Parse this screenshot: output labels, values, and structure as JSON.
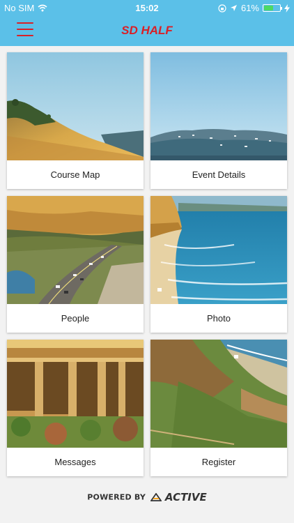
{
  "status": {
    "carrier": "No SIM",
    "time": "15:02",
    "battery": "61%",
    "battery_level": 0.61
  },
  "header": {
    "title": "SD HALF"
  },
  "tiles": [
    {
      "label": "Course Map"
    },
    {
      "label": "Event Details"
    },
    {
      "label": "People"
    },
    {
      "label": "Photo"
    },
    {
      "label": "Messages"
    },
    {
      "label": "Register"
    }
  ],
  "footer": {
    "powered_by": "POWERED BY",
    "brand": "ACTIVE"
  },
  "colors": {
    "bar": "#5bc0e8",
    "accent": "#d92027"
  }
}
